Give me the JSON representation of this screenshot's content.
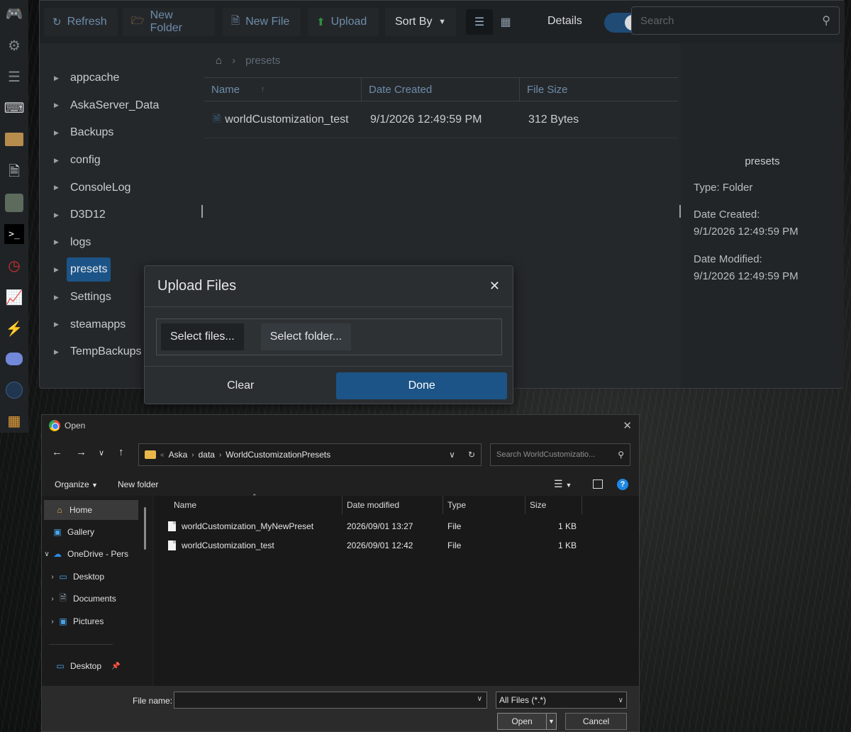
{
  "rail": {
    "icons": [
      "gamepad-icon",
      "gears-icon",
      "sliders-icon",
      "keyboard-icon",
      "folder-icon",
      "file-pulse-icon",
      "steam-icon",
      "terminal-icon",
      "clock-icon",
      "chart-icon",
      "lightning-icon",
      "discord-icon",
      "wmods-icon",
      "table-icon"
    ],
    "colors": [
      "#2f8f3e",
      "#7d8488",
      "#7d8488",
      "#c9ccd0",
      "#b68c4c",
      "#c9ccd0",
      "#8a9a8a",
      "#ffffff",
      "#d12f2f",
      "#6d8caa",
      "#d8c21a",
      "#7289da",
      "#3b5d85",
      "#e8a23b"
    ]
  },
  "toolbar": {
    "refresh": "Refresh",
    "new_folder": "New Folder",
    "new_file": "New File",
    "upload": "Upload",
    "sort_by": "Sort By",
    "details": "Details",
    "search_placeholder": "Search"
  },
  "tree": {
    "items": [
      {
        "label": "appcache"
      },
      {
        "label": "AskaServer_Data"
      },
      {
        "label": "Backups"
      },
      {
        "label": "config"
      },
      {
        "label": "ConsoleLog"
      },
      {
        "label": "D3D12"
      },
      {
        "label": "logs"
      },
      {
        "label": "presets"
      },
      {
        "label": "Settings"
      },
      {
        "label": "steamapps"
      },
      {
        "label": "TempBackups"
      }
    ],
    "selected": "presets"
  },
  "breadcrumb": {
    "current": "presets"
  },
  "grid": {
    "headers": [
      "Name",
      "Date Created",
      "File Size"
    ],
    "rows": [
      {
        "name": "worldCustomization_test",
        "date": "9/1/2026 12:49:59 PM",
        "size": "312 Bytes"
      }
    ]
  },
  "info": {
    "title": "presets",
    "type": "Type: Folder",
    "created_label": "Date Created:",
    "created_value": "9/1/2026 12:49:59 PM",
    "modified_label": "Date Modified:",
    "modified_value": "9/1/2026 12:49:59 PM"
  },
  "upload_dialog": {
    "title": "Upload Files",
    "select_files": "Select files...",
    "select_folder": "Select folder...",
    "clear": "Clear",
    "done": "Done"
  },
  "open_dialog": {
    "title": "Open",
    "path": [
      "Aska",
      "data",
      "WorldCustomizationPresets"
    ],
    "search_placeholder": "Search WorldCustomizatio...",
    "organize": "Organize",
    "new_folder": "New folder",
    "nav": [
      {
        "label": "Home"
      },
      {
        "label": "Gallery"
      },
      {
        "label": "OneDrive - Pers"
      },
      {
        "label": "Desktop"
      },
      {
        "label": "Documents"
      },
      {
        "label": "Pictures"
      },
      {
        "label": "Desktop"
      }
    ],
    "columns": [
      "Name",
      "Date modified",
      "Type",
      "Size"
    ],
    "files": [
      {
        "name": "worldCustomization_MyNewPreset",
        "date": "2026/09/01 13:27",
        "type": "File",
        "size": "1 KB"
      },
      {
        "name": "worldCustomization_test",
        "date": "2026/09/01 12:42",
        "type": "File",
        "size": "1 KB"
      }
    ],
    "file_name_label": "File name:",
    "file_name_value": "",
    "file_type": "All Files (*.*)",
    "open": "Open",
    "cancel": "Cancel"
  }
}
